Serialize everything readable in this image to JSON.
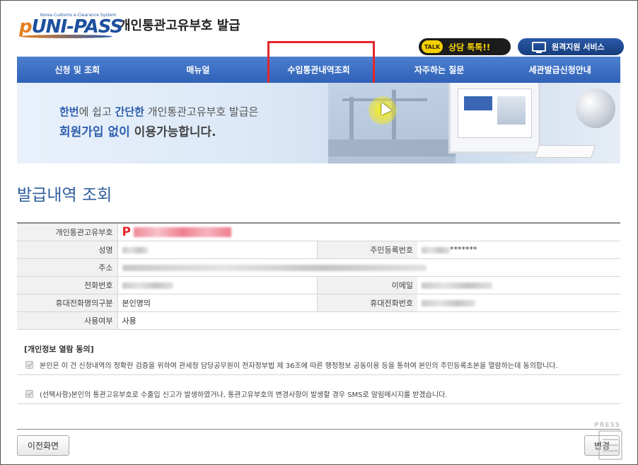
{
  "header": {
    "logo_small_text": "Korea Customs e-Clearance System",
    "logo_text_p": "p",
    "logo_text_rest": "UNI-PASS",
    "title": "개인통관고유부호 발급",
    "talk_badge": "TALK",
    "talk_button": "상담 톡톡!!",
    "remote_button": "원격지원 서비스"
  },
  "nav": {
    "items": [
      {
        "label": "신청 및 조회"
      },
      {
        "label": "매뉴얼"
      },
      {
        "label": "수입통관내역조회"
      },
      {
        "label": "자주하는 질문"
      },
      {
        "label": "세관발급신청안내"
      }
    ]
  },
  "banner": {
    "line1_a": "한번",
    "line1_b": "에 쉽고 ",
    "line1_c": "간단한",
    "line1_d": " 개인통관고유부호 발급은",
    "line2_a": "회원가입 없이",
    "line2_b": " 이용가능합니다."
  },
  "page": {
    "title": "발급내역 조회"
  },
  "info": {
    "customs_code_label": "개인통관고유부호",
    "customs_code_prefix": "P",
    "name_label": "성명",
    "rrn_label": "주민등록번호",
    "rrn_masked": "*******",
    "address_label": "주소",
    "phone_label": "전화번호",
    "email_label": "이메일",
    "mobile_owner_label": "휴대전화명의구분",
    "mobile_owner_value": "본인명의",
    "mobile_label": "휴대전화번호",
    "usage_label": "사용여부",
    "usage_value": "사용"
  },
  "consent": {
    "title": "[개인정보 열람 동의]",
    "item1": "본인은 이 건 신청내역의 정확한 검증을 위하여 관세청 담당공무원이 전자정부법 제 36조에 따른 행정정보 공동이용 등을 통하여 본인의 주민등록초본을 열람하는데 동의합니다.",
    "item2": "(선택사항)본인의 통관고유부호로 수출입 신고가 발생하였거나, 통관고유부호의 변경사항이 발생할 경우 SMS로 알림메시지를 받겠습니다."
  },
  "buttons": {
    "prev": "이전화면",
    "change": "변경"
  },
  "watermark": "PRESS"
}
